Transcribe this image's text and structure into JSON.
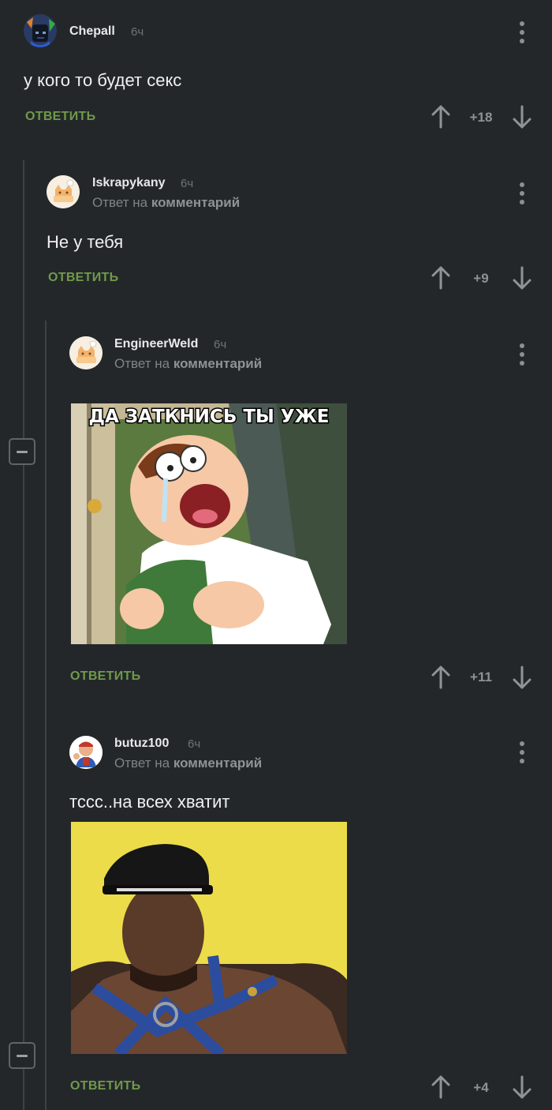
{
  "comments": [
    {
      "username": "Chepall",
      "time": "6ч",
      "text": "у кого то будет секс",
      "reply_label": "ОТВЕТИТЬ",
      "score": "+18",
      "avatar_icon": "dark-character-avatar-icon"
    },
    {
      "username": "Iskrapykany",
      "time": "6ч",
      "reply_prefix": "Ответ на",
      "reply_target": "комментарий",
      "text": "Не у тебя",
      "reply_label": "ОТВЕТИТЬ",
      "score": "+9",
      "avatar_icon": "cat-default-avatar-icon"
    },
    {
      "username": "EngineerWeld",
      "time": "6ч",
      "reply_prefix": "Ответ на",
      "reply_target": "комментарий",
      "image_caption": "ДА ЗАТКНИСЬ ТЫ УЖЕ",
      "reply_label": "ОТВЕТИТЬ",
      "score": "+11",
      "avatar_icon": "cat-default-avatar-icon"
    },
    {
      "username": "butuz100",
      "time": "6ч",
      "reply_prefix": "Ответ на",
      "reply_target": "комментарий",
      "text": "тссс..на всех хватит",
      "reply_label": "ОТВЕТИТЬ",
      "score": "+4",
      "avatar_icon": "worker-cartoon-avatar-icon"
    }
  ],
  "colors": {
    "background": "#24272a",
    "reply_button": "#6f9a4a",
    "thread_line": "#3d4246"
  }
}
